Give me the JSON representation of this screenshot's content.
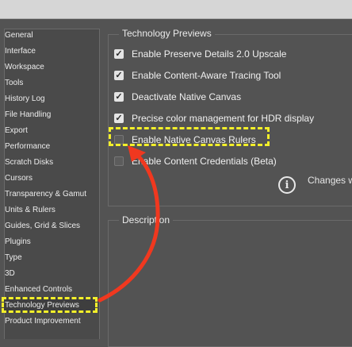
{
  "sidebar": {
    "items": [
      {
        "label": "General"
      },
      {
        "label": "Interface"
      },
      {
        "label": "Workspace"
      },
      {
        "label": "Tools"
      },
      {
        "label": "History Log"
      },
      {
        "label": "File Handling"
      },
      {
        "label": "Export"
      },
      {
        "label": "Performance"
      },
      {
        "label": "Scratch Disks"
      },
      {
        "label": "Cursors"
      },
      {
        "label": "Transparency & Gamut"
      },
      {
        "label": "Units & Rulers"
      },
      {
        "label": "Guides, Grid & Slices"
      },
      {
        "label": "Plugins"
      },
      {
        "label": "Type"
      },
      {
        "label": "3D"
      },
      {
        "label": "Enhanced Controls"
      },
      {
        "label": "Technology Previews"
      },
      {
        "label": "Product Improvement"
      }
    ],
    "selected": "Technology Previews"
  },
  "tech_previews": {
    "title": "Technology Previews",
    "options": [
      {
        "label": "Enable Preserve Details 2.0 Upscale",
        "checked": true
      },
      {
        "label": "Enable Content-Aware Tracing Tool",
        "checked": true
      },
      {
        "label": "Deactivate Native Canvas",
        "checked": true
      },
      {
        "label": "Precise color management for HDR display",
        "checked": true
      },
      {
        "label": "Enable Native Canvas Rulers",
        "checked": false
      },
      {
        "label": "Enable Content Credentials (Beta)",
        "checked": false
      }
    ],
    "info_text": "Changes w"
  },
  "description": {
    "title": "Description"
  },
  "colors": {
    "highlight": "#f3ef2a",
    "arrow": "#f0381f"
  },
  "icons": {
    "info": "info-circle-icon",
    "check": "checkmark-icon",
    "arrow": "curved-arrow-icon"
  }
}
